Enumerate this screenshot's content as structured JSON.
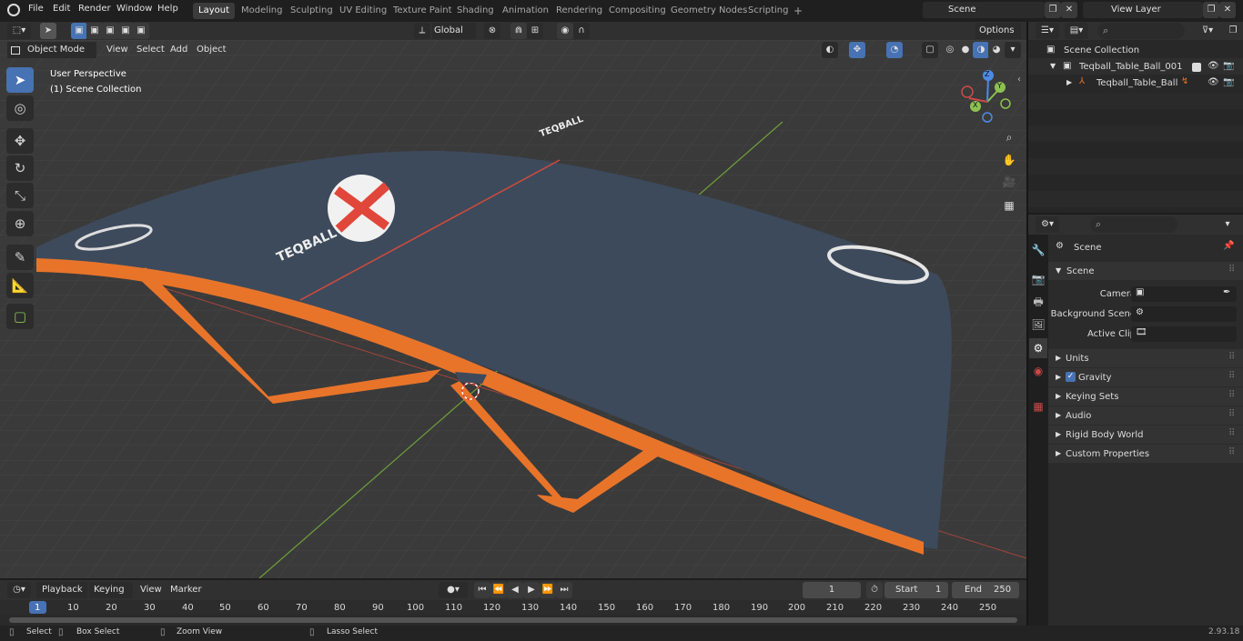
{
  "menu": [
    "File",
    "Edit",
    "Render",
    "Window",
    "Help"
  ],
  "workspaces": [
    "Layout",
    "Modeling",
    "Sculpting",
    "UV Editing",
    "Texture Paint",
    "Shading",
    "Animation",
    "Rendering",
    "Compositing",
    "Geometry Nodes",
    "Scripting",
    "+"
  ],
  "scene_name": "Scene",
  "view_layer": "View Layer",
  "viewport_header": {
    "mode": "Object Mode",
    "menus": [
      "View",
      "Select",
      "Add",
      "Object"
    ],
    "orientation": "Global",
    "options": "Options"
  },
  "viewport": {
    "perspective": "User Perspective",
    "collection": "(1) Scene Collection",
    "scene_text": [
      "TEQBALL",
      "TEQBALL"
    ],
    "gizmo": {
      "x": "X",
      "y": "Y",
      "z": "Z"
    }
  },
  "outliner": {
    "root": "Scene Collection",
    "items": [
      {
        "label": "Teqball_Table_Ball_001"
      },
      {
        "label": "Teqball_Table_Ball"
      }
    ]
  },
  "properties": {
    "header": "Scene",
    "section": "Scene",
    "fields": [
      {
        "label": "Camera",
        "value": ""
      },
      {
        "label": "Background Scene",
        "value": ""
      },
      {
        "label": "Active Clip",
        "value": ""
      }
    ],
    "panels": [
      "Units",
      "Gravity",
      "Keying Sets",
      "Audio",
      "Rigid Body World",
      "Custom Properties"
    ]
  },
  "timeline": {
    "menus": [
      "Playback",
      "Keying",
      "View",
      "Marker"
    ],
    "current_frame": "1",
    "start_label": "Start",
    "start": "1",
    "end_label": "End",
    "end": "250",
    "ticks": [
      "1",
      "10",
      "20",
      "30",
      "40",
      "50",
      "60",
      "70",
      "80",
      "90",
      "100",
      "110",
      "120",
      "130",
      "140",
      "150",
      "160",
      "170",
      "180",
      "190",
      "200",
      "210",
      "220",
      "230",
      "240",
      "250"
    ]
  },
  "statusbar": {
    "items": [
      "Select",
      "Box Select",
      "Zoom View",
      "Lasso Select"
    ],
    "version": "2.93.18"
  },
  "colors": {
    "accent": "#4772b3",
    "table": "#3d4a5c",
    "frame": "#e8742a",
    "ball_red": "#e0473a"
  }
}
